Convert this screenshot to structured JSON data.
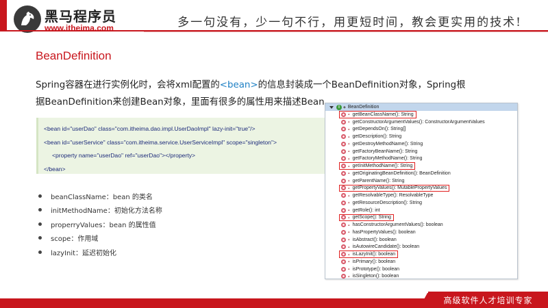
{
  "header": {
    "brand_name": "黑马程序员",
    "brand_url": "www.itheima.com",
    "slogan": "多一句没有，少一句不行，用更短时间，教会更实用的技术!"
  },
  "title": "BeanDefinition",
  "paragraph": {
    "part1": "Spring容器在进行实例化时，会将xml配置的",
    "tag": "<bean>",
    "part2": "的信息封装成一个BeanDefinition对象，Spring根据BeanDefinition来创建Bean对象，里面有很多的属性用来描述Bean"
  },
  "code": [
    "<bean id=\"userDao\"  class=\"com.itheima.dao.impl.UserDaoImpl\"  lazy-init=\"true\"/>",
    "<bean id=\"userService\"  class=\"com.itheima.service.UserServiceImpl\"  scope=\"singleton\">",
    "<property name=\"userDao\" ref=\"userDao\"></property>",
    "</bean>"
  ],
  "bullets": [
    "beanClassName：bean 的类名",
    "initMethodName：初始化方法名称",
    "properryValues：bean 的属性值",
    "scope：作用域",
    "lazyInit：延迟初始化"
  ],
  "outline": {
    "class_name": "BeanDefinition",
    "class_icon_letter": "I",
    "method_icon": "public-method-icon",
    "methods": [
      "getBeanClassName(): String",
      "getConstructorArgumentValues(): ConstructorArgumentValues",
      "getDependsOn(): String[]",
      "getDescription(): String",
      "getDestroyMethodName(): String",
      "getFactoryBeanName(): String",
      "getFactoryMethodName(): String",
      "getInitMethodName(): String",
      "getOriginatingBeanDefinition(): BeanDefinition",
      "getParentName(): String",
      "getPropertyValues(): MutablePropertyValues",
      "getResolvableType(): ResolvableType",
      "getResourceDescription(): String",
      "getRole(): int",
      "getScope(): String",
      "hasConstructorArgumentValues(): boolean",
      "hasPropertyValues(): boolean",
      "isAbstract(): boolean",
      "isAutowireCandidate(): boolean",
      "isLazyInit(): boolean",
      "isPrimary(): boolean",
      "isPrototype(): boolean",
      "isSingleton(): boolean"
    ],
    "highlighted_methods": [
      0,
      7,
      10,
      14,
      19
    ]
  },
  "footer": {
    "tagline": "高级软件人才培训专家"
  },
  "colors": {
    "brand_red": "#c8161d",
    "code_background": "#ecf4e3",
    "link_blue": "#1d7fc4",
    "highlight_red": "#e01e1e"
  }
}
